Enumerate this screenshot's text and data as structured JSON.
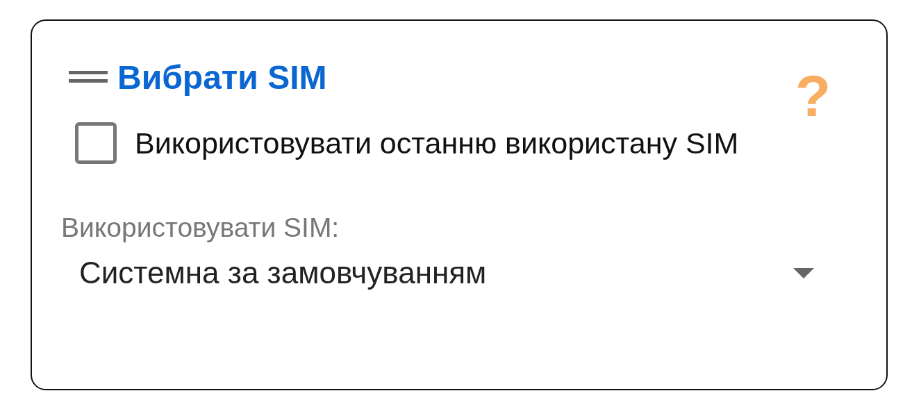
{
  "card": {
    "title": "Вибрати SIM",
    "help": "?"
  },
  "checkbox": {
    "label": "Використовувати останню використану SIM",
    "checked": false
  },
  "sim_select": {
    "label": "Використовувати SIM:",
    "value": "Системна за замовчуванням"
  }
}
